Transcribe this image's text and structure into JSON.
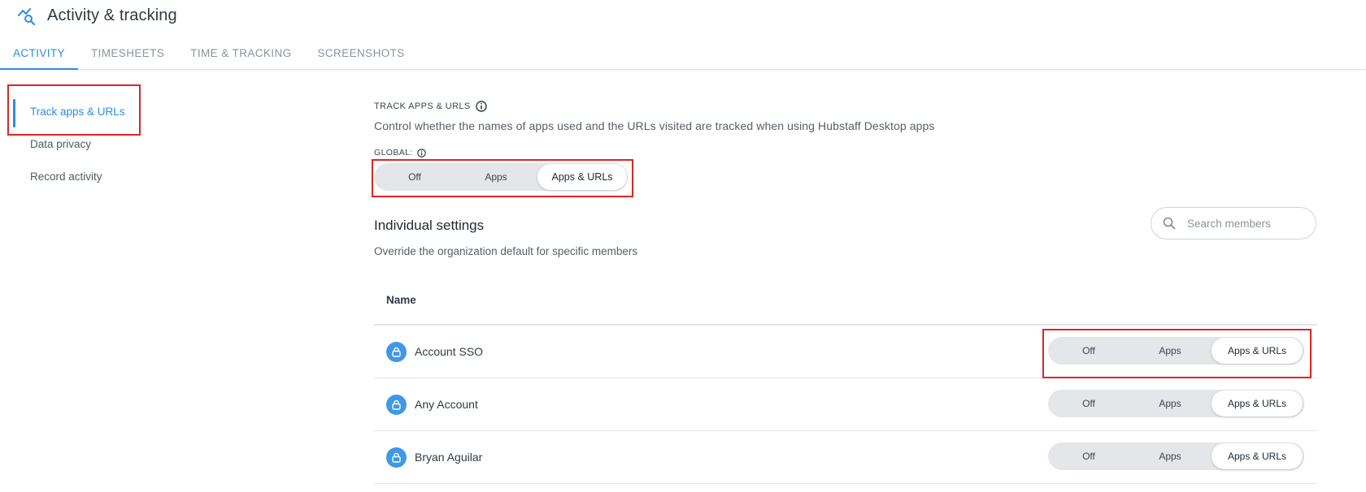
{
  "header": {
    "title": "Activity & tracking",
    "icon": "activity-search-icon",
    "accent": "#2a8de6"
  },
  "tabs": [
    {
      "label": "ACTIVITY",
      "active": true
    },
    {
      "label": "TIMESHEETS",
      "active": false
    },
    {
      "label": "TIME & TRACKING",
      "active": false
    },
    {
      "label": "SCREENSHOTS",
      "active": false
    }
  ],
  "sidebar": {
    "items": [
      {
        "label": "Track apps & URLs",
        "active": true
      },
      {
        "label": "Data privacy",
        "active": false
      },
      {
        "label": "Record activity",
        "active": false
      }
    ]
  },
  "track": {
    "section_label": "TRACK APPS & URLS",
    "description": "Control whether the names of apps used and the URLs visited are tracked when using Hubstaff Desktop apps",
    "global_label": "GLOBAL:",
    "options": [
      "Off",
      "Apps",
      "Apps & URLs"
    ],
    "selected": "Apps & URLs"
  },
  "individual": {
    "title": "Individual settings",
    "description": "Override the organization default for specific members",
    "search_placeholder": "Search members",
    "column_name": "Name",
    "members": [
      {
        "name": "Account SSO",
        "options": [
          "Off",
          "Apps",
          "Apps & URLs"
        ],
        "selected": "Apps & URLs"
      },
      {
        "name": "Any Account",
        "options": [
          "Off",
          "Apps",
          "Apps & URLs"
        ],
        "selected": "Apps & URLs"
      },
      {
        "name": "Bryan Aguilar",
        "options": [
          "Off",
          "Apps",
          "Apps & URLs"
        ],
        "selected": "Apps & URLs"
      }
    ]
  },
  "highlight_color": "#e02424"
}
